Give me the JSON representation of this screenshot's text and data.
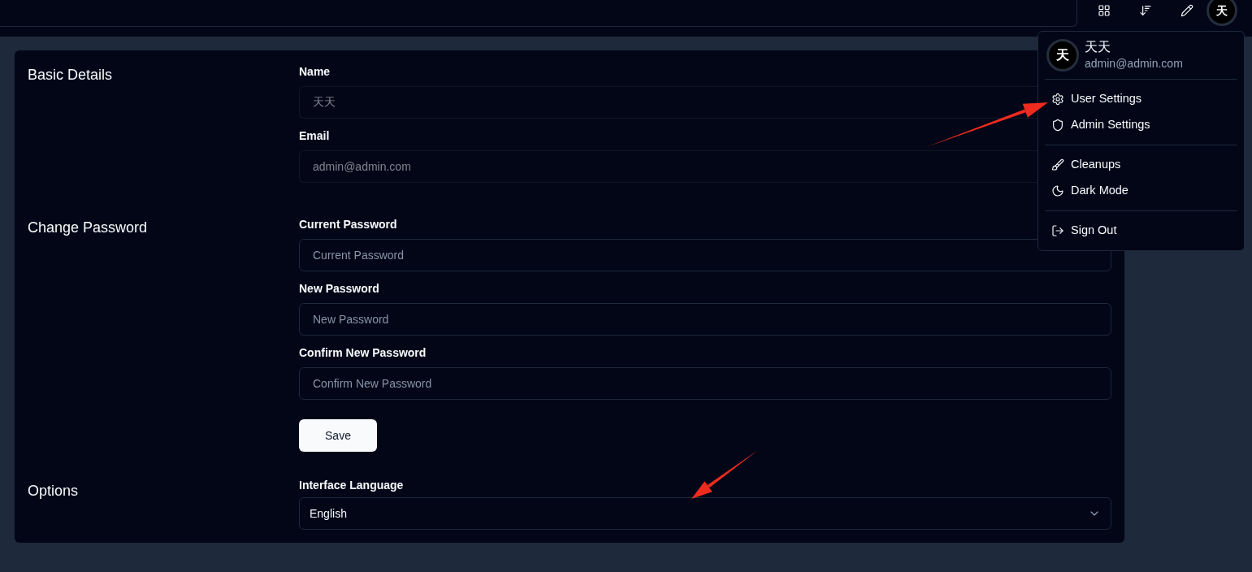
{
  "top_bar": {
    "avatar": "天"
  },
  "settings": {
    "sections": [
      {
        "title": "Basic Details",
        "fields": [
          {
            "kind": "input",
            "label": "Name",
            "value": "天天",
            "disabled": true
          },
          {
            "kind": "input",
            "label": "Email",
            "value": "admin@admin.com",
            "disabled": true
          }
        ]
      },
      {
        "title": "Change Password",
        "fields": [
          {
            "kind": "input",
            "label": "Current Password",
            "placeholder": "Current Password",
            "disabled": false
          },
          {
            "kind": "input",
            "label": "New Password",
            "placeholder": "New Password",
            "disabled": false
          },
          {
            "kind": "input",
            "label": "Confirm New Password",
            "placeholder": "Confirm New Password",
            "disabled": false
          }
        ],
        "button": "Save"
      },
      {
        "title": "Options",
        "fields": [
          {
            "kind": "select",
            "label": "Interface Language",
            "value": "English",
            "disabled": false
          }
        ]
      }
    ]
  },
  "user_menu": {
    "avatar": "天",
    "name": "天天",
    "email": "admin@admin.com",
    "groups": [
      {
        "items": [
          "User Settings",
          "Admin Settings"
        ]
      },
      {
        "items": [
          "Cleanups",
          "Dark Mode"
        ]
      },
      {
        "items": [
          "Sign Out"
        ]
      }
    ]
  }
}
